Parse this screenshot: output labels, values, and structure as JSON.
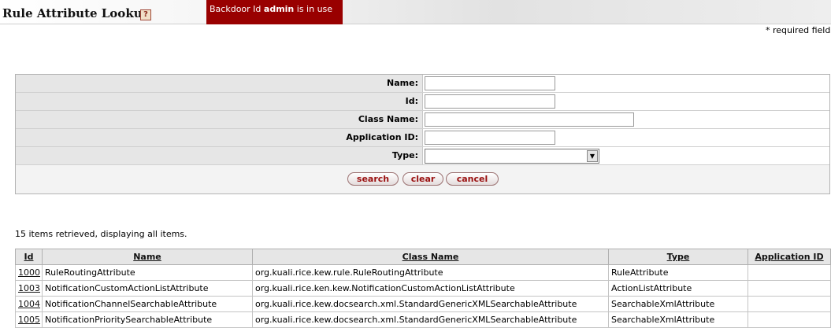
{
  "header": {
    "title": "Rule Attribute Lookup",
    "help_icon": "help-icon",
    "help_glyph": "?",
    "backdoor": {
      "prefix": "Backdoor Id ",
      "user": "admin",
      "suffix": " is in use"
    }
  },
  "required_note": "* required field",
  "form": {
    "fields": [
      {
        "label": "Name:",
        "type": "text",
        "value": ""
      },
      {
        "label": "Id:",
        "type": "text",
        "value": ""
      },
      {
        "label": "Class Name:",
        "type": "text",
        "value": ""
      },
      {
        "label": "Application ID:",
        "type": "text",
        "value": ""
      },
      {
        "label": "Type:",
        "type": "select",
        "value": ""
      }
    ],
    "buttons": {
      "search": "search",
      "clear": "clear",
      "cancel": "cancel"
    }
  },
  "results": {
    "summary": "15 items retrieved, displaying all items.",
    "columns": [
      "Id",
      "Name",
      "Class Name",
      "Type",
      "Application ID"
    ],
    "rows": [
      {
        "id": "1000",
        "name": "RuleRoutingAttribute",
        "class_name": "org.kuali.rice.kew.rule.RuleRoutingAttribute",
        "type": "RuleAttribute",
        "application_id": ""
      },
      {
        "id": "1003",
        "name": "NotificationCustomActionListAttribute",
        "class_name": "org.kuali.rice.ken.kew.NotificationCustomActionListAttribute",
        "type": "ActionListAttribute",
        "application_id": ""
      },
      {
        "id": "1004",
        "name": "NotificationChannelSearchableAttribute",
        "class_name": "org.kuali.rice.kew.docsearch.xml.StandardGenericXMLSearchableAttribute",
        "type": "SearchableXmlAttribute",
        "application_id": ""
      },
      {
        "id": "1005",
        "name": "NotificationPrioritySearchableAttribute",
        "class_name": "org.kuali.rice.kew.docsearch.xml.StandardGenericXMLSearchableAttribute",
        "type": "SearchableXmlAttribute",
        "application_id": ""
      }
    ]
  }
}
